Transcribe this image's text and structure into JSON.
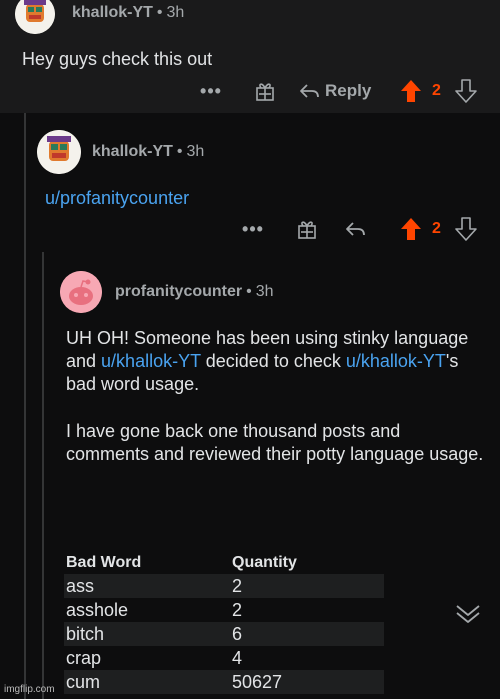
{
  "comments": [
    {
      "username": "khallok-YT",
      "separator": "•",
      "time": "3h",
      "body": "Hey guys check this out",
      "actions": {
        "more": "•••",
        "reply_label": "Reply",
        "votes": "2"
      }
    },
    {
      "username": "khallok-YT",
      "separator": "•",
      "time": "3h",
      "body_link": "u/profanitycounter",
      "actions": {
        "more": "•••",
        "votes": "2"
      }
    },
    {
      "username": "profanitycounter",
      "separator": "•",
      "time": "3h",
      "p1_part1": "UH OH! Someone has been using stinky language and ",
      "p1_link1": "u/khallok-YT",
      "p1_part2": " decided to check ",
      "p1_link2": "u/khallok-YT",
      "p1_part3": "'s bad word usage.",
      "p2": "I have gone back one thousand posts and comments and reviewed their potty language usage.",
      "table": {
        "headers": [
          "Bad Word",
          "Quantity"
        ],
        "rows": [
          {
            "word": "ass",
            "qty": "2"
          },
          {
            "word": "asshole",
            "qty": "2"
          },
          {
            "word": "bitch",
            "qty": "6"
          },
          {
            "word": "crap",
            "qty": "4"
          },
          {
            "word": "cum",
            "qty": "50627"
          }
        ]
      }
    }
  ],
  "colors": {
    "upvote": "#ff4500",
    "link": "#4aa3f0",
    "background": "#0d0d0e",
    "card": "#1a1a1b"
  },
  "icons": [
    "award-icon",
    "reply-icon",
    "upvote-icon",
    "downvote-icon",
    "collapse-chevron-icon"
  ],
  "watermark": "imgflip.com"
}
